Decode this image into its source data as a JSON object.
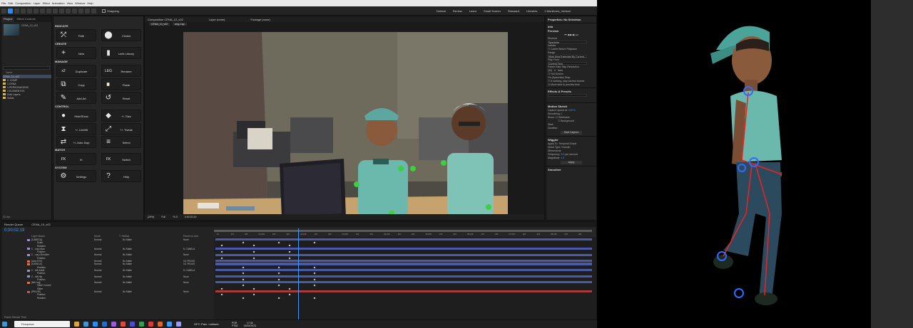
{
  "menubar": {
    "items": [
      "File",
      "Edit",
      "Composition",
      "Layer",
      "Effect",
      "Animation",
      "View",
      "Window",
      "Help"
    ]
  },
  "toolbar": {
    "snapping_label": "Snapping",
    "workspaces": [
      "Default",
      "Review",
      "Learn",
      "Small Screen",
      "Standard",
      "Libraries",
      "2.Monitores_Vertical"
    ]
  },
  "project": {
    "tabs": [
      "Project",
      "Effect Controls"
    ],
    "name_col": "Name",
    "items": [
      {
        "name": "CENA_10_v02",
        "selected": true,
        "folder": false
      },
      {
        "name": "0. COMP",
        "selected": false,
        "folder": true
      },
      {
        "name": "1.CENA",
        "selected": false,
        "folder": true
      },
      {
        "name": "1.PERSONAGENS",
        "selected": false,
        "folder": true
      },
      {
        "name": "2.ELEMENTOS",
        "selected": false,
        "folder": true
      },
      {
        "name": "Duik Layers",
        "selected": false,
        "folder": true
      },
      {
        "name": "Solids",
        "selected": false,
        "folder": true
      }
    ],
    "bpc": "32 bpc"
  },
  "script": {
    "sections": {
      "indicate": "INDICATE",
      "create": "CREATE",
      "manage": "MANAGE",
      "control": "CONTROL",
      "match": "MATCH",
      "system": "SYSTEM"
    },
    "buttons": [
      {
        "label": "Path",
        "icon": "⤱"
      },
      {
        "label": "Circles",
        "icon": "⬤"
      },
      {
        "label": "New",
        "icon": "+"
      },
      {
        "label": "Limb Library",
        "icon": "▮"
      },
      {
        "label": "Duplicate",
        "icon": "x2"
      },
      {
        "label": "Rename",
        "icon": "LEG"
      },
      {
        "label": "Copy",
        "icon": "⧉"
      },
      {
        "label": "Paste",
        "icon": "📋"
      },
      {
        "label": "Add Art",
        "icon": "✎"
      },
      {
        "label": "Reset",
        "icon": "↺"
      },
      {
        "label": "Hide/Show",
        "icon": "●"
      },
      {
        "label": "+/- Size",
        "icon": "◆"
      },
      {
        "label": "+/- Limbfit",
        "icon": "⧗"
      },
      {
        "label": "+/- Tweak",
        "icon": "⤢"
      },
      {
        "label": "+/- Auto-Swp",
        "icon": "⇄"
      },
      {
        "label": "Select",
        "icon": "≡"
      },
      {
        "label": "IK",
        "icon": "FK"
      },
      {
        "label": "Switch",
        "icon": "FK"
      },
      {
        "label": "Settings",
        "icon": "⚙"
      },
      {
        "label": "Help",
        "icon": "?"
      }
    ],
    "match_left_value": "IK",
    "match_right_value": "to IK"
  },
  "comp": {
    "tabs": [
      "Composition CENA_10_v02",
      "Layer (none)",
      "Footage (none)"
    ],
    "subtabs": [
      "CENA_10_v02",
      "ang-Cap"
    ],
    "footer": {
      "zoom": "(29%)",
      "resolution": "Full",
      "exposure": "+0.0",
      "timecode": "0;00;02;19"
    }
  },
  "props": {
    "title": "Properties: No Selection",
    "info": "Info",
    "preview": "Preview",
    "shortcut_label": "Shortcut",
    "shortcut_value": "Spacebar",
    "include": "Include",
    "cache": "Cache Before Playback",
    "range_label": "Range",
    "range_value": "Work Area Extended By Current...",
    "play_from_label": "Play From",
    "play_from_value": "Current Time",
    "frame_rate_label": "Frame Rate",
    "skip_label": "Skip",
    "resolution_label": "Resolution",
    "frame_rate_value": "(30)",
    "skip_value": "0",
    "resolution_value": "Auto",
    "full_screen": "Full Screen",
    "on_stop": "On (Spacebar) Stop:",
    "if_caching": "If caching, play cached frames",
    "move_time": "Move time to preview time",
    "effects_presets": "Effects & Presets",
    "motion_sketch": "Motion Sketch",
    "capture_speed": "Capture speed at:",
    "capture_speed_value": "100 %",
    "smoothing_label": "Smoothing:",
    "smoothing_value": "1",
    "show_label": "Show:",
    "wireframe": "Wireframe",
    "background": "Background",
    "start_label": "Start:",
    "duration_label": "Duration:",
    "start_capture": "Start Capture",
    "wiggler": "Wiggler",
    "apply_to_label": "Apply To:",
    "apply_to_value": "Temporal Graph",
    "noise_type_label": "Noise Type:",
    "noise_type_value": "Smooth",
    "dimensions_label": "Dimensions:",
    "frequency_label": "Frequency:",
    "frequency_value": "5.0",
    "frequency_unit": "per second",
    "magnitude_label": "Magnitude:",
    "magnitude_value": "1.0",
    "apply_btn": "Apply",
    "smoother": "Smoother"
  },
  "timeline": {
    "tabs": [
      "Render Queue",
      "CENA_10_v02"
    ],
    "current_time": "0;00;02;19",
    "headers": {
      "name": "Layer Name",
      "mode": "Mode",
      "trkmat": "T  TrkMat",
      "parent": "Parent & Link"
    },
    "ticks": [
      "0f",
      "10f",
      "20f",
      "01;00f",
      "10f",
      "20f",
      "02;00f",
      "10f",
      "20f",
      "03;00f",
      "10f",
      "20f",
      "04;00f",
      "10f",
      "20f",
      "05;00f",
      "10f",
      "20f",
      "06;00f",
      "10f",
      "20f",
      "07;00f",
      "10f",
      "20f",
      "08;00f",
      "10f",
      "20f"
    ],
    "layers": [
      {
        "name": "[CABECA]",
        "mode": "Normal",
        "trkmat": "No Matte",
        "parent": "None",
        "color": "#a08fd0",
        "bar": "#4b5aa8"
      },
      {
        "name": "Scale",
        "mode": "",
        "trkmat": "",
        "parent": "",
        "color": "",
        "bar": ""
      },
      {
        "name": "Rotation",
        "mode": "",
        "trkmat": "",
        "parent": "",
        "color": "",
        "bar": ""
      },
      {
        "name": "C - corp-Mao",
        "mode": "Normal",
        "trkmat": "No Matte",
        "parent": "8. CANELA",
        "color": "#a08fd0",
        "bar": "#4b5aa8"
      },
      {
        "name": "Position",
        "mode": "",
        "trkmat": "",
        "parent": "",
        "color": "",
        "bar": ""
      },
      {
        "name": "C - corp-Shoulder",
        "mode": "Normal",
        "trkmat": "No Matte",
        "parent": "None",
        "color": "#a08fd0",
        "bar": "#4b5aa8"
      },
      {
        "name": "Position",
        "mode": "",
        "trkmat": "",
        "parent": "",
        "color": "",
        "bar": ""
      },
      {
        "name": "[corp-Ferr]",
        "mode": "Normal",
        "trkmat": "No Matte",
        "parent": "16. PELVIS",
        "color": "#d8744f",
        "bar": "#4b5aa8"
      },
      {
        "name": "[CANELA]",
        "mode": "Normal",
        "trkmat": "No Matte",
        "parent": "15. PELVIS",
        "color": "#d8744f",
        "bar": "#4b5aa8"
      },
      {
        "name": "Rotation",
        "mode": "",
        "trkmat": "",
        "parent": "",
        "color": "",
        "bar": ""
      },
      {
        "name": "C - left-Ankle",
        "mode": "Normal",
        "trkmat": "No Matte",
        "parent": "8. CANELA",
        "color": "#a08fd0",
        "bar": "#4b5aa8"
      },
      {
        "name": "Position",
        "mode": "",
        "trkmat": "",
        "parent": "",
        "color": "",
        "bar": ""
      },
      {
        "name": "C - left-Hip",
        "mode": "Normal",
        "trkmat": "No Matte",
        "parent": "None",
        "color": "#a08fd0",
        "bar": "#4b5aa8"
      },
      {
        "name": "Position",
        "mode": "",
        "trkmat": "",
        "parent": "",
        "color": "",
        "bar": ""
      },
      {
        "name": "[left-Leg]",
        "mode": "Normal",
        "trkmat": "No Matte",
        "parent": "None",
        "color": "#d8744f",
        "bar": "#4b5aa8"
      },
      {
        "name": "Slider Control",
        "mode": "",
        "trkmat": "",
        "parent": "",
        "color": "",
        "bar": ""
      },
      {
        "name": "Slider",
        "mode": "",
        "trkmat": "",
        "parent": "",
        "color": "",
        "bar": ""
      },
      {
        "name": "[PELVIS]",
        "mode": "Normal",
        "trkmat": "No Matte",
        "parent": "None",
        "color": "#d84f4f",
        "bar": "#a83a3a"
      },
      {
        "name": "Position",
        "mode": "",
        "trkmat": "",
        "parent": "",
        "color": "",
        "bar": ""
      },
      {
        "name": "Rotation",
        "mode": "",
        "trkmat": "",
        "parent": "",
        "color": "",
        "bar": ""
      }
    ],
    "footer": "Frame Render Time"
  },
  "taskbar": {
    "search_placeholder": "Pesquisar",
    "weather": "28°C  Parc. nublado",
    "lang_line1": "POR",
    "lang_line2": "PTB2",
    "clock_time": "17:44",
    "clock_date": "15/03/2023",
    "icon_colors": [
      "#e0a33b",
      "#3a96dd",
      "#2d8ceb",
      "#1f6fd1",
      "#9a5bd8",
      "#e8443a",
      "#4c4ccf",
      "#2da44e",
      "#d83b3b",
      "#ea5f22",
      "#3e9bf5",
      "#9999ff"
    ]
  },
  "colors": {
    "accent": "#3e9bf5",
    "ae_purple": "#9999ff",
    "joint_green": "#3fce3f",
    "rig_red": "#ee2222",
    "rig_blue": "#2f6bff"
  }
}
